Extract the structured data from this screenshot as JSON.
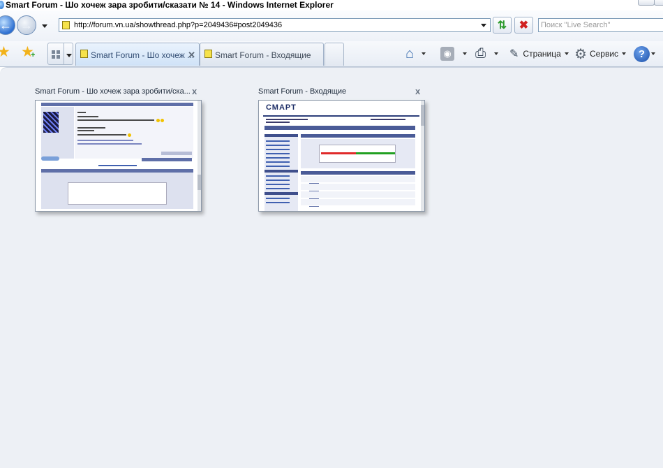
{
  "window": {
    "title": "Smart Forum - Шо хочеж зара зробити/сказати № 14 - Windows Internet Explorer"
  },
  "address_bar": {
    "url": "http://forum.vn.ua/showthread.php?p=2049436#post2049436"
  },
  "search": {
    "placeholder": "Поиск \"Live Search\""
  },
  "tabs": [
    {
      "label": "Smart Forum - Шо хочеж ..."
    },
    {
      "label": "Smart Forum - Входящие"
    }
  ],
  "command_bar": {
    "page_label": "Страница",
    "tools_label": "Сервис",
    "feed_symbol": "◉",
    "help_symbol": "?"
  },
  "quick_tabs": [
    {
      "title": "Smart Forum - Шо хочеж зара зробити/ска...",
      "close": "x"
    },
    {
      "title": "Smart Forum - Входящие",
      "close": "x",
      "brand": "СМАРТ"
    }
  ],
  "icons": {
    "back": "back-arrow-icon",
    "forward": "forward-arrow-icon",
    "refresh": "refresh-icon",
    "stop": "stop-icon",
    "favorites": "favorites-star-icon",
    "add_favorites": "add-favorites-icon",
    "quick_tabs": "quick-tabs-icon",
    "home": "home-icon",
    "feeds": "feeds-icon",
    "print": "print-icon",
    "page": "page-icon",
    "tools": "gear-icon",
    "help": "help-icon"
  },
  "colors": {
    "accent": "#2d6fd1",
    "content_bg": "#edf0f5",
    "stop_red": "#d02020",
    "refresh_green": "#2c9a2c"
  }
}
